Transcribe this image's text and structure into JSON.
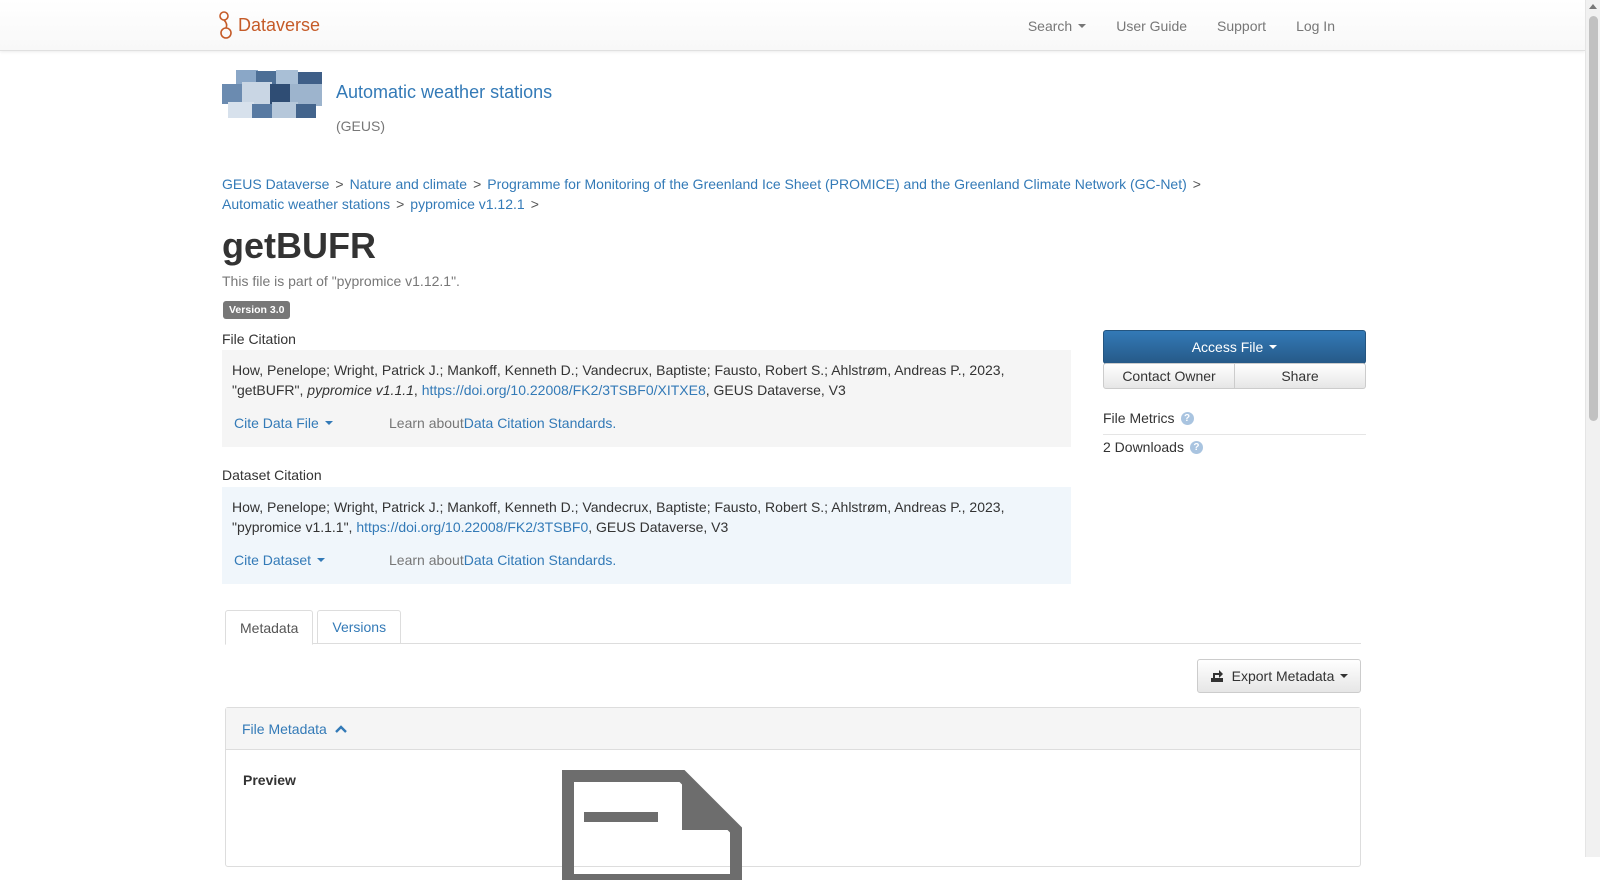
{
  "navbar": {
    "brand": "Dataverse",
    "search_label": "Search",
    "user_guide": "User Guide",
    "support": "Support",
    "log_in": "Log In"
  },
  "dataverse": {
    "name": "Automatic weather stations",
    "affiliation": "(GEUS)"
  },
  "breadcrumb": [
    "GEUS Dataverse",
    "Nature and climate",
    "Programme for Monitoring of the Greenland Ice Sheet (PROMICE) and the Greenland Climate Network (GC-Net)",
    "Automatic weather stations",
    "pypromice v1.12.1"
  ],
  "breadcrumb_separator": ">",
  "file": {
    "title": "getBUFR",
    "part_of": "This file is part of \"pypromice v1.12.1\".",
    "version_badge": "Version 3.0"
  },
  "file_citation": {
    "heading": "File Citation",
    "text_prefix": "How, Penelope; Wright, Patrick J.; Mankoff, Kenneth D.; Vandecrux, Baptiste; Fausto, Robert S.; Ahlstrøm, Andreas P., 2023, \"getBUFR\", ",
    "dataset_italic": "pypromice v1.1.1",
    "text_mid": ", ",
    "doi_link": "https://doi.org/10.22008/FK2/3TSBF0/XITXE8",
    "text_suffix": ", GEUS Dataverse, V3",
    "cite_dropdown": "Cite Data File",
    "learn_prefix": "Learn about ",
    "learn_link": "Data Citation Standards."
  },
  "dataset_citation": {
    "heading": "Dataset Citation",
    "text_prefix": "How, Penelope; Wright, Patrick J.; Mankoff, Kenneth D.; Vandecrux, Baptiste; Fausto, Robert S.; Ahlstrøm, Andreas P., 2023, \"pypromice v1.1.1\", ",
    "doi_link": "https://doi.org/10.22008/FK2/3TSBF0",
    "text_suffix": ", GEUS Dataverse, V3",
    "cite_dropdown": "Cite Dataset",
    "learn_prefix": "Learn about ",
    "learn_link": "Data Citation Standards."
  },
  "actions": {
    "access_file": "Access File",
    "contact_owner": "Contact Owner",
    "share": "Share"
  },
  "metrics": {
    "heading": "File Metrics",
    "downloads": "2 Downloads",
    "help_glyph": "?"
  },
  "tabs": [
    {
      "label": "Metadata",
      "active": true
    },
    {
      "label": "Versions",
      "active": false
    }
  ],
  "export_metadata": "Export Metadata",
  "metadata_panel": {
    "title": "File Metadata",
    "preview_label": "Preview"
  },
  "colors": {
    "brand": "#c55b28",
    "link": "#337ab7",
    "primary_button": "#2d6ca2",
    "citation_bg_file": "#f5f5f5",
    "citation_bg_dataset": "#f0f6fb"
  },
  "icons": {
    "brand": "dataverse-logo-icon",
    "export": "export-icon",
    "collapse": "chevron-up-icon",
    "preview": "file-document-icon",
    "help": "question-circle-icon"
  }
}
